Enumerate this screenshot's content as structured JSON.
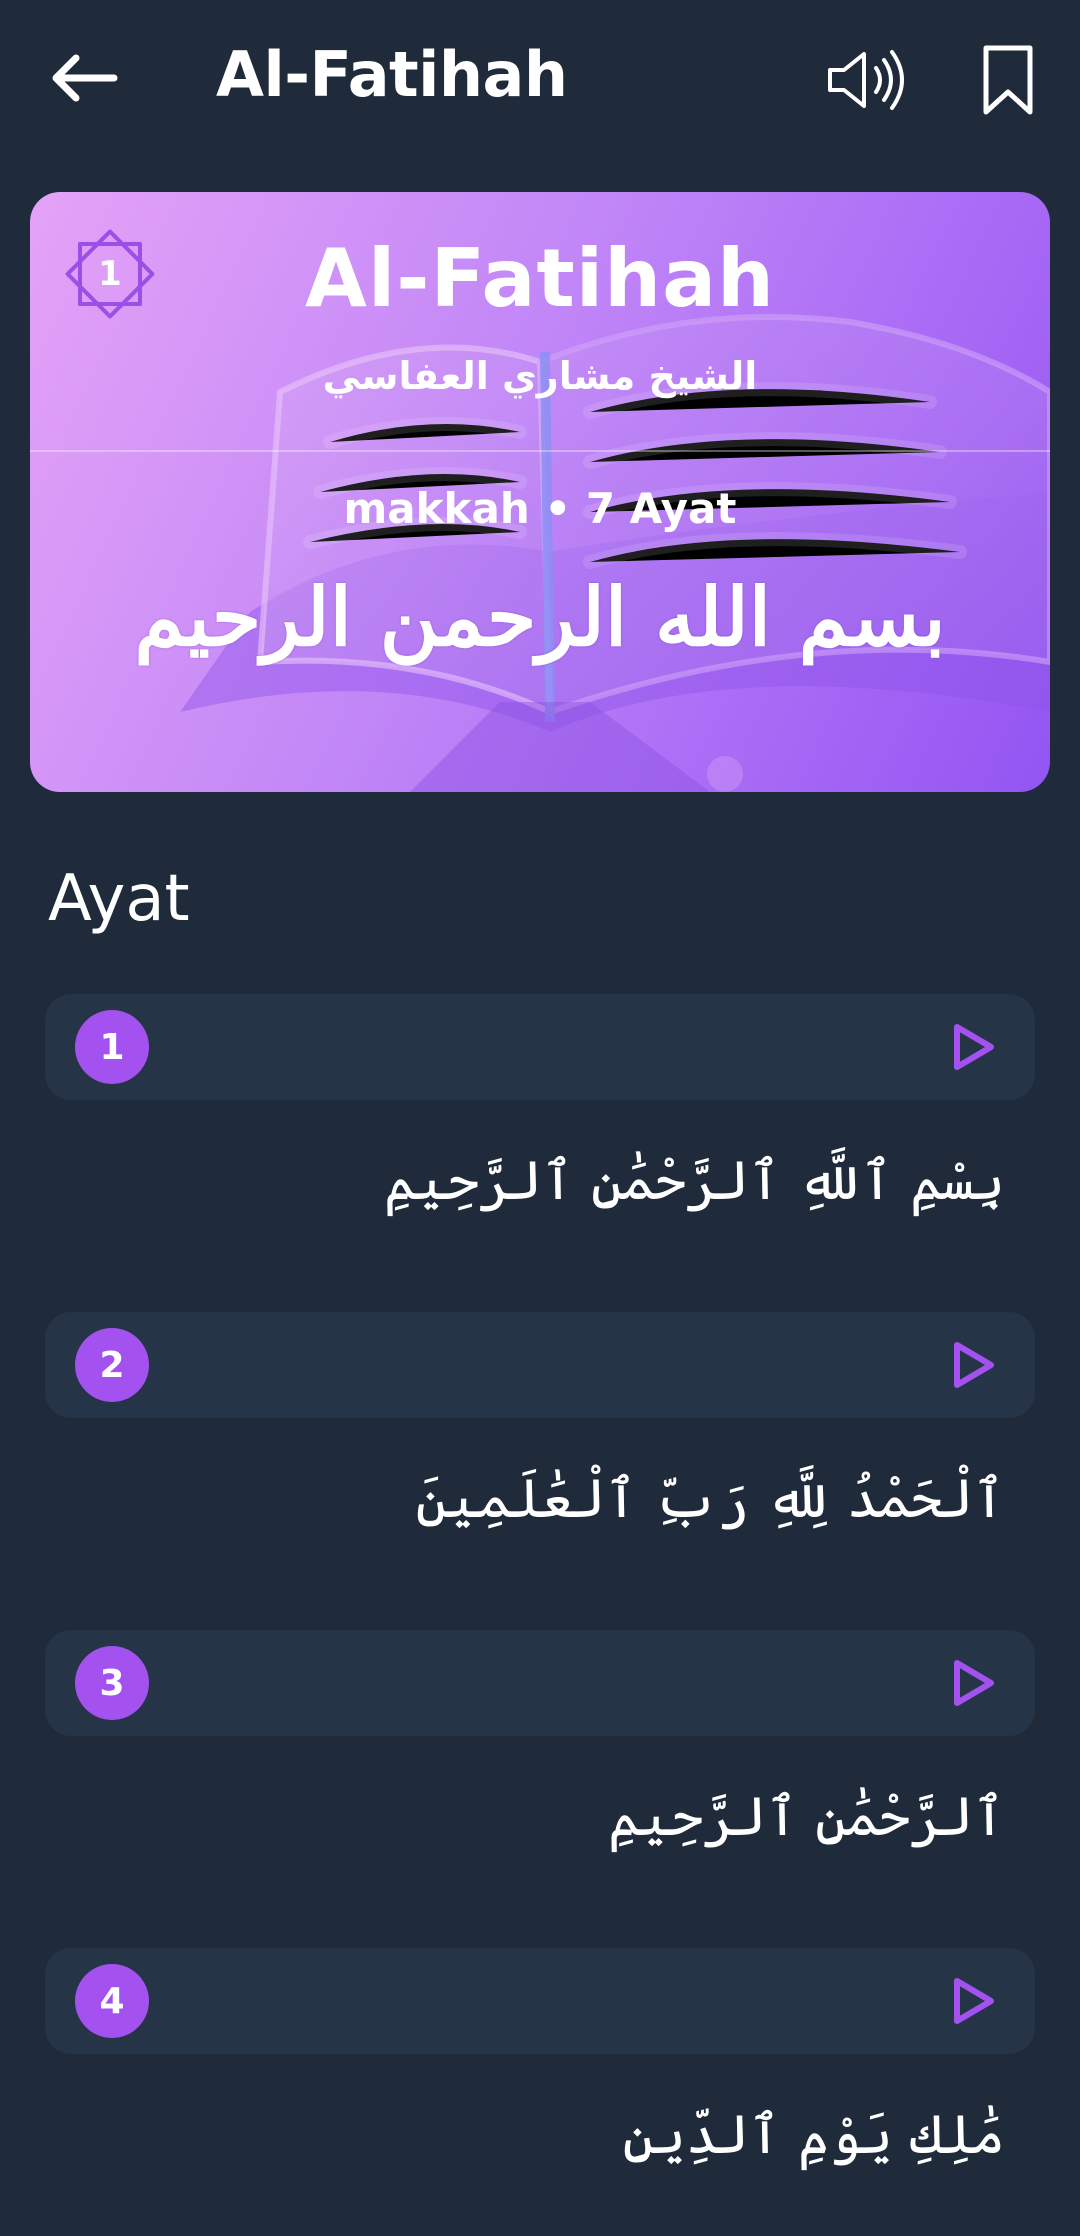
{
  "appbar": {
    "title": "Al-Fatihah",
    "back_icon": "arrow-left-icon",
    "audio_icon": "speaker-icon",
    "bookmark_icon": "bookmark-icon"
  },
  "hero": {
    "number": "1",
    "title": "Al-Fatihah",
    "reciter": "الشيخ مشاري العفاسي",
    "meta": "makkah • 7 Ayat",
    "basmala": "بسم الله الرحمن الرحيم"
  },
  "section": {
    "title": "Ayat"
  },
  "ayat": [
    {
      "number": "1",
      "text": "بِسْمِ ٱللَّهِ ٱلرَّحْمَٰنِ ٱلرَّحِيمِ"
    },
    {
      "number": "2",
      "text": "ٱلْحَمْدُ لِلَّهِ رَبِّ ٱلْعَٰلَمِينَ"
    },
    {
      "number": "3",
      "text": "ٱلرَّحْمَٰنِ ٱلرَّحِيمِ"
    },
    {
      "number": "4",
      "text": "مَٰلِكِ يَوْمِ ٱلدِّينِ"
    }
  ],
  "colors": {
    "background": "#1f2a3b",
    "card": "#263447",
    "accent": "#a352f0",
    "hero_start": "#e4a3f7",
    "hero_end": "#9355f2"
  }
}
